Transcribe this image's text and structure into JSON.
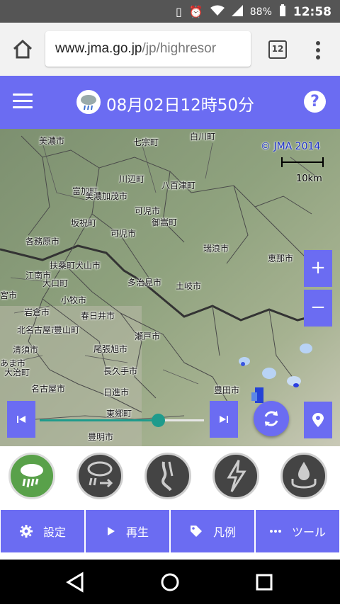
{
  "status_bar": {
    "battery": "88%",
    "time": "12:58"
  },
  "browser": {
    "url_host": "www.jma.go.jp",
    "url_path": "/jp/highresor",
    "tab_count": "12"
  },
  "header": {
    "title": "08月02日12時50分",
    "help_label": "?"
  },
  "map": {
    "copyright": "© JMA 2014",
    "scale_label": "10km",
    "cities": [
      "美濃市",
      "七宗町",
      "白川町",
      "川辺町",
      "富加町",
      "美濃加茂市",
      "八百津町",
      "坂祝町",
      "可児市",
      "御嵩町",
      "各務原市",
      "可児市",
      "瑞浪市",
      "恵那市",
      "扶桑町",
      "犬山市",
      "江南市",
      "大口町",
      "多治見市",
      "土岐市",
      "宮市",
      "小牧市",
      "岩倉市",
      "春日井市",
      "北名古屋市",
      "豊山町",
      "瀬戸市",
      "清須市",
      "尾張旭市",
      "あま市",
      "大治町",
      "長久手市",
      "名古屋市",
      "日進市",
      "豊田市",
      "東郷町",
      "豊明市"
    ],
    "zoom_in": "+",
    "zoom_out": "−"
  },
  "timeline": {
    "progress": 0.72
  },
  "layers": [
    {
      "name": "rain-now",
      "active": true
    },
    {
      "name": "rain-forecast",
      "active": false
    },
    {
      "name": "tornado",
      "active": false
    },
    {
      "name": "lightning",
      "active": false
    },
    {
      "name": "precip-intensity",
      "active": false
    }
  ],
  "toolbar": {
    "settings": "設定",
    "play": "再生",
    "legend": "凡例",
    "tools": "ツール"
  },
  "colors": {
    "accent": "#6b6cf2",
    "slider": "#1f9b8c"
  }
}
